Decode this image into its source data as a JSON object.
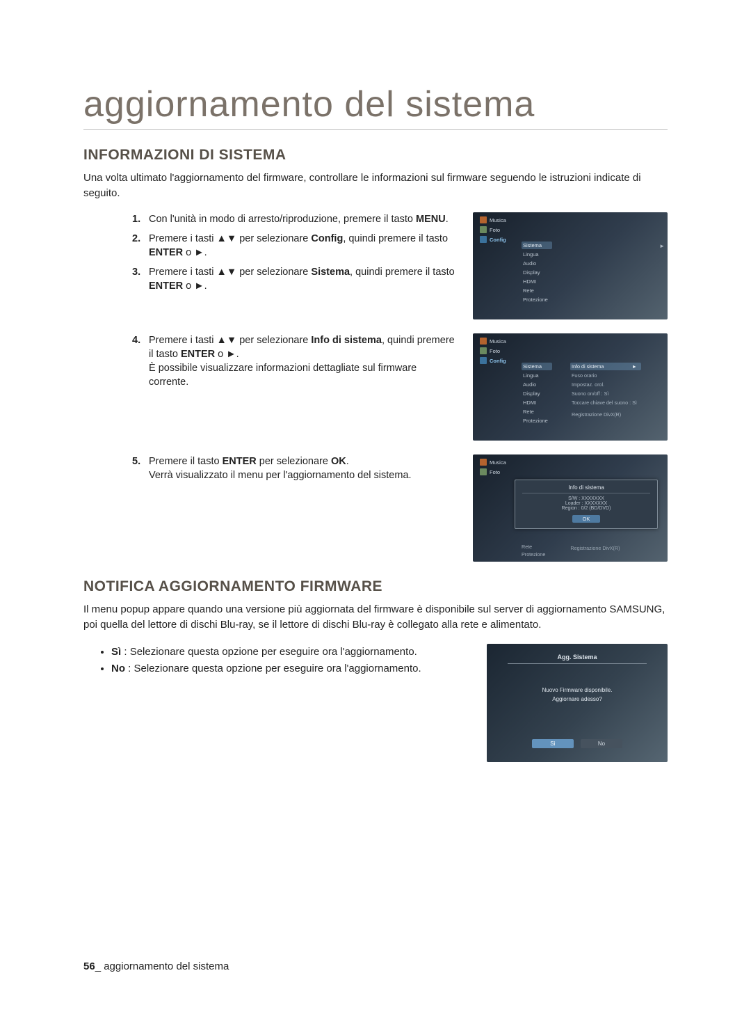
{
  "page_title": "aggiornamento del sistema",
  "section_info": {
    "heading": "INFORMAZIONI DI SISTEMA",
    "intro": "Una volta ultimato l'aggiornamento del firmware, controllare le informazioni sul firmware seguendo le istruzioni indicate di seguito."
  },
  "steps": {
    "s1_num": "1.",
    "s1_a": "Con l'unità in modo di arresto/riproduzione, premere il tasto ",
    "s1_b": "MENU",
    "s1_c": ".",
    "s2_num": "2.",
    "s2_a": "Premere i tasti ",
    "s2_arrows": "▲▼",
    "s2_b": " per selezionare ",
    "s2_bold": "Config",
    "s2_c": ", quindi premere il tasto ",
    "s2_enter": "ENTER",
    "s2_d": " o ►.",
    "s3_num": "3.",
    "s3_a": "Premere i tasti ",
    "s3_arrows": "▲▼",
    "s3_b": " per selezionare ",
    "s3_bold": "Sistema",
    "s3_c": ", quindi premere il tasto ",
    "s3_enter": "ENTER",
    "s3_d": " o ►.",
    "s4_num": "4.",
    "s4_a": "Premere i tasti ",
    "s4_arrows": "▲▼",
    "s4_b": " per selezionare ",
    "s4_bold": "Info di sistema",
    "s4_c": ", quindi premere il tasto ",
    "s4_enter": "ENTER",
    "s4_d": " o ►.",
    "s4_e": "È possibile visualizzare informazioni dettagliate sul firmware corrente.",
    "s5_num": "5.",
    "s5_a": "Premere il tasto ",
    "s5_enter": "ENTER",
    "s5_b": " per selezionare ",
    "s5_bold": "OK",
    "s5_c": ".",
    "s5_d": "Verrà visualizzato il menu per l'aggiornamento del sistema."
  },
  "screenshot1": {
    "nav_music": "Musica",
    "nav_photo": "Foto",
    "nav_config": "Config",
    "menu": [
      "Sistema",
      "Lingua",
      "Audio",
      "Display",
      "HDMI",
      "Rete",
      "Protezione"
    ],
    "menu_selected_index": 0
  },
  "screenshot2": {
    "nav_music": "Musica",
    "nav_photo": "Foto",
    "nav_config": "Config",
    "menu": [
      "Sistema",
      "Lingua",
      "Audio",
      "Display",
      "HDMI",
      "Rete",
      "Protezione"
    ],
    "menu_selected_index": 0,
    "sub": [
      {
        "label": "Info di sistema",
        "value": ""
      },
      {
        "label": "Fuso orario",
        "value": ""
      },
      {
        "label": "Impostaz. orol.",
        "value": ""
      },
      {
        "label": "Suono on/off",
        "value": ": Sì"
      },
      {
        "label": "Toccare chiave del suono",
        "value": ": Sì"
      },
      {
        "label": "",
        "value": ""
      },
      {
        "label": "Registrazione DivX(R)",
        "value": ""
      }
    ],
    "sub_selected_index": 0
  },
  "screenshot3": {
    "nav_music": "Musica",
    "nav_photo": "Foto",
    "popup_title": "Info di sistema",
    "popup_line1": "S/W : XXXXXXX",
    "popup_line2": "Loader : XXXXXXX",
    "popup_line3": "Region : 0/2 (BD/DVD)",
    "popup_ok": "OK",
    "under_left": [
      "Rete",
      "Protezione"
    ],
    "under_right": [
      "",
      "Registrazione DivX(R)"
    ]
  },
  "section_notify": {
    "heading": "NOTIFICA AGGIORNAMENTO FIRMWARE",
    "intro": "Il menu popup appare quando una versione più aggiornata del firmware è disponibile sul server di aggiornamento SAMSUNG, poi quella del lettore di dischi Blu-ray, se il lettore di dischi Blu-ray è collegato alla rete e alimentato.",
    "bullet_si_label": "Sì",
    "bullet_si_text": " : Selezionare questa opzione per eseguire ora l'aggiornamento.",
    "bullet_no_label": "No",
    "bullet_no_text": " : Selezionare questa opzione per eseguire ora l'aggiornamento."
  },
  "notify_screenshot": {
    "title": "Agg. Sistema",
    "msg1": "Nuovo Firmware disponibile.",
    "msg2": "Aggiornare adesso?",
    "btn_si": "Sì",
    "btn_no": "No"
  },
  "footer": {
    "page_num": "56",
    "sep": "_ ",
    "text": "aggiornamento del sistema"
  }
}
